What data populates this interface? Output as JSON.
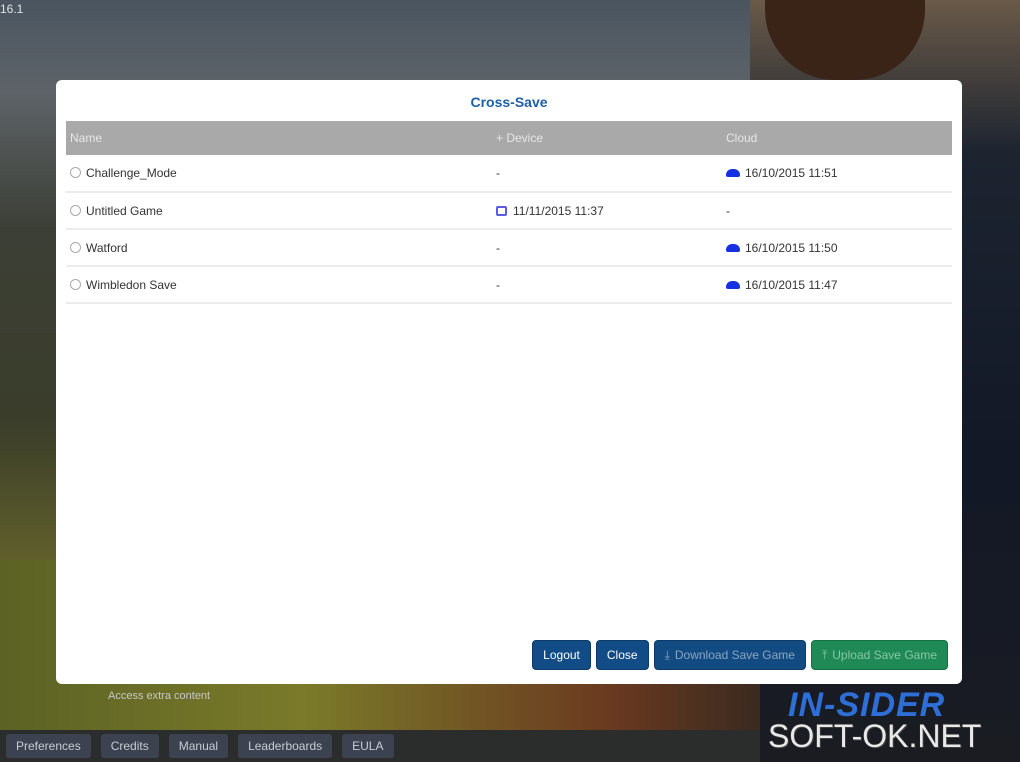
{
  "version": "16.1",
  "modal": {
    "title": "Cross-Save",
    "columns": {
      "name": "Name",
      "device": "+ Device",
      "cloud": "Cloud"
    },
    "rows": [
      {
        "name": "Challenge_Mode",
        "device": "-",
        "cloud": "16/10/2015 11:51"
      },
      {
        "name": "Untitled Game",
        "device": "11/11/2015 11:37",
        "cloud": "-"
      },
      {
        "name": "Watford",
        "device": "-",
        "cloud": "16/10/2015 11:50"
      },
      {
        "name": "Wimbledon Save",
        "device": "-",
        "cloud": "16/10/2015 11:47"
      }
    ],
    "buttons": {
      "logout": "Logout",
      "close": "Close",
      "download": "Download Save Game",
      "upload": "Upload Save Game"
    }
  },
  "extra_content": "Access extra content",
  "footer": [
    "Preferences",
    "Credits",
    "Manual",
    "Leaderboards",
    "EULA"
  ],
  "logo": "IN-SIDER",
  "watermark": "SOFT-OK.NET"
}
